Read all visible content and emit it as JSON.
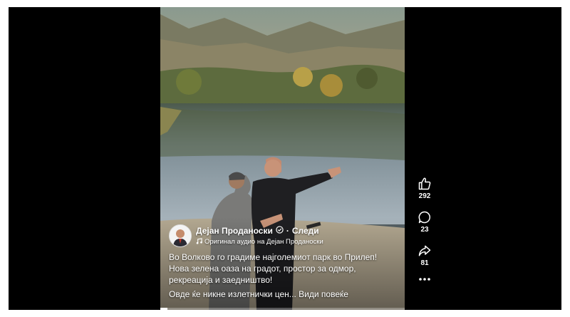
{
  "reel": {
    "author_name": "Дејан Проданоски",
    "separator": "·",
    "follow_label": "Следи",
    "audio_text": "Оригинал аудио на Дејан Проданоски",
    "caption_text": "Во Волково го градиме најголемиот парк во Прилеп! Нова зелена оаза на градот, простор за одмор, рекреација и заедништво!",
    "caption_more_text": "Овде ќе никне излетнички цен...",
    "see_more_label": "Види повеќе",
    "progress_fraction": 0.03
  },
  "actions": {
    "likes": "292",
    "comments": "23",
    "shares": "81"
  },
  "icons": {
    "like": "thumbs-up-icon",
    "comment": "comment-bubble-icon",
    "share": "share-arrow-icon",
    "more": "more-dots-icon",
    "audio": "music-note-icon",
    "verified": "verified-badge-icon"
  }
}
